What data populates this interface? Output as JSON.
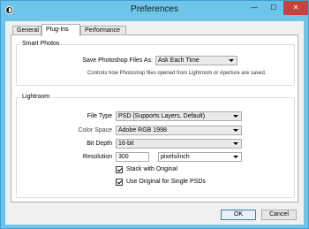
{
  "window": {
    "title": "Preferences",
    "minimize_glyph": "—",
    "maximize_glyph": "☐",
    "close_glyph": "✕",
    "app_icon": "circle-half-icon"
  },
  "tabs": [
    {
      "label": "General",
      "active": false
    },
    {
      "label": "Plug-Ins",
      "active": true
    },
    {
      "label": "Performance",
      "active": false
    }
  ],
  "smart_photos": {
    "legend": "Smart Photos",
    "save_as_label": "Save Photoshop Files As:",
    "save_as_value": "Ask Each Time",
    "hint": "Controls how Photoshop files opened from Lightroom or Aperture are saved."
  },
  "lightroom": {
    "legend": "Lightroom",
    "file_type_label": "File Type",
    "file_type_value": "PSD (Supports Layers, Default)",
    "color_space_label": "Color Space",
    "color_space_value": "Adobe RGB 1998",
    "bit_depth_label": "Bit Depth",
    "bit_depth_value": "16-bit",
    "resolution_label": "Resolution",
    "resolution_value": "300",
    "resolution_unit": "pixels/inch",
    "stack_label": "Stack with Original",
    "stack_checked": true,
    "use_original_label": "Use Original for Single PSDs",
    "use_original_checked": true
  },
  "buttons": {
    "ok": "OK",
    "cancel": "Cancel"
  }
}
